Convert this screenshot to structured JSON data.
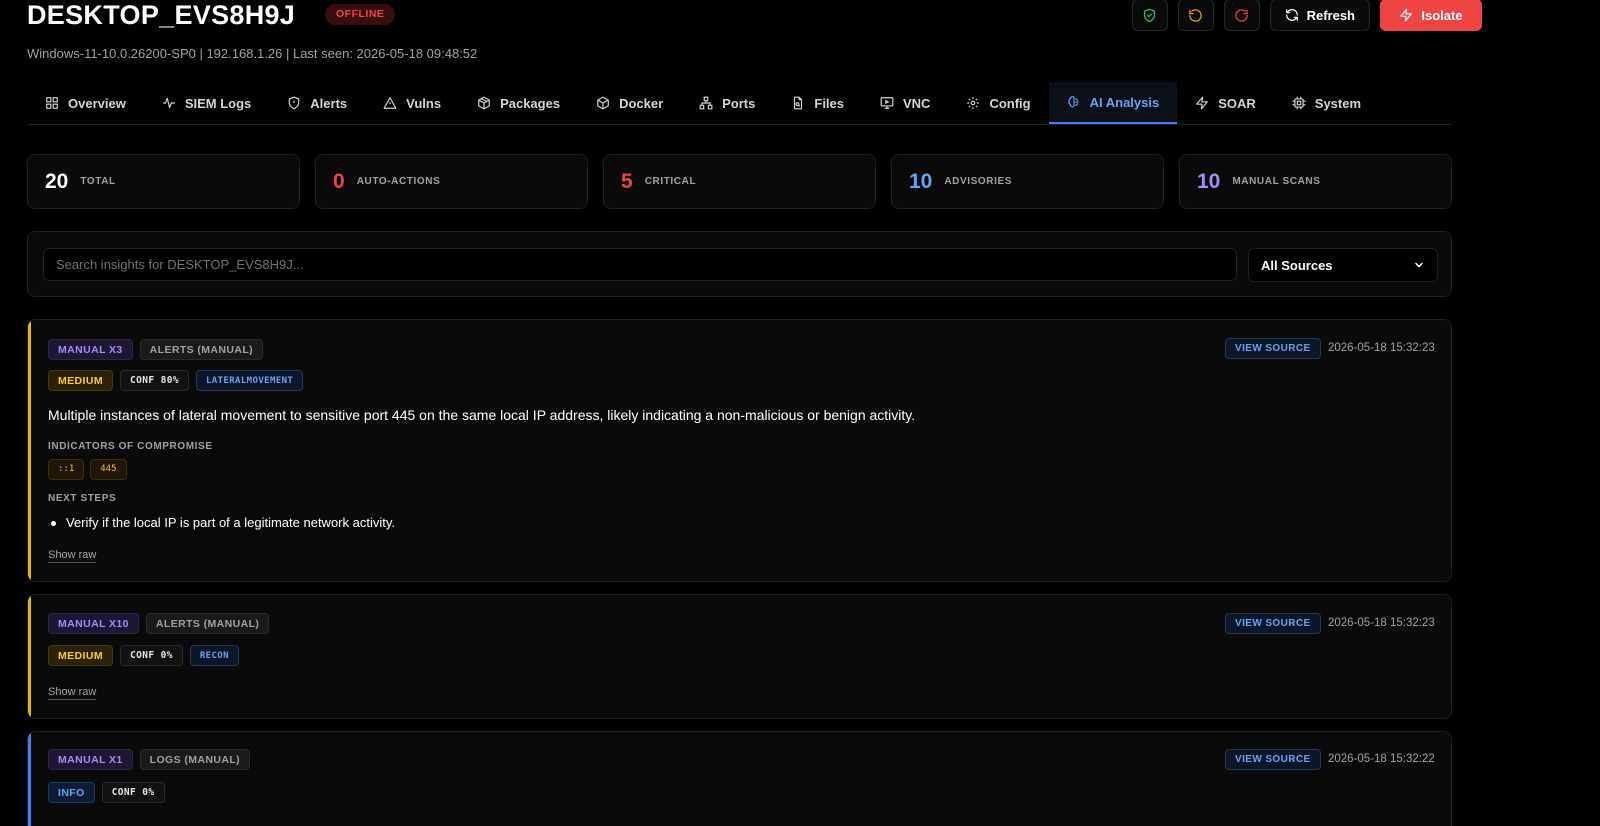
{
  "host": {
    "name": "DESKTOP_EVS8H9J",
    "status": "OFFLINE",
    "subline": "Windows-11-10.0.26200-SP0 | 192.168.1.26 | Last seen: 2026-05-18 09:48:52"
  },
  "actions": {
    "icons": [
      "shield-check-icon",
      "rotate-ccw-icon",
      "restart-icon"
    ],
    "refresh_label": "Refresh",
    "isolate_label": "Isolate"
  },
  "tabs": [
    {
      "label": "Overview",
      "icon": "grid-icon",
      "active": false
    },
    {
      "label": "SIEM Logs",
      "icon": "activity-icon",
      "active": false
    },
    {
      "label": "Alerts",
      "icon": "shield-icon",
      "active": false
    },
    {
      "label": "Vulns",
      "icon": "warning-icon",
      "active": false
    },
    {
      "label": "Packages",
      "icon": "package-icon",
      "active": false
    },
    {
      "label": "Docker",
      "icon": "box-icon",
      "active": false
    },
    {
      "label": "Ports",
      "icon": "network-icon",
      "active": false
    },
    {
      "label": "Files",
      "icon": "file-icon",
      "active": false
    },
    {
      "label": "VNC",
      "icon": "monitor-icon",
      "active": false
    },
    {
      "label": "Config",
      "icon": "gear-icon",
      "active": false
    },
    {
      "label": "AI Analysis",
      "icon": "brain-icon",
      "active": true
    },
    {
      "label": "SOAR",
      "icon": "bolt-icon",
      "active": false
    },
    {
      "label": "System",
      "icon": "cpu-icon",
      "active": false
    }
  ],
  "stats": [
    {
      "value": "20",
      "label": "TOTAL",
      "color": "#ffffff"
    },
    {
      "value": "0",
      "label": "AUTO-ACTIONS",
      "color": "#ef4444"
    },
    {
      "value": "5",
      "label": "CRITICAL",
      "color": "#ef4444"
    },
    {
      "value": "10",
      "label": "ADVISORIES",
      "color": "#60a5fa"
    },
    {
      "value": "10",
      "label": "MANUAL SCANS",
      "color": "#a78bfa"
    }
  ],
  "search": {
    "placeholder": "Search insights for DESKTOP_EVS8H9J...",
    "value": "",
    "source_filter": "All Sources"
  },
  "insights": [
    {
      "run_label": "MANUAL X3",
      "source_label": "ALERTS (MANUAL)",
      "severity": "MEDIUM",
      "confidence": "CONF 80%",
      "tag": "LATERALMOVEMENT",
      "view_source_label": "VIEW SOURCE",
      "timestamp": "2026-05-18 15:32:23",
      "summary": "Multiple instances of lateral movement to sensitive port 445 on the same local IP address, likely indicating a non-malicious or benign activity.",
      "ioc_label": "INDICATORS OF COMPROMISE",
      "iocs": [
        "::1",
        "445"
      ],
      "next_steps_label": "NEXT STEPS",
      "next_steps": [
        "Verify if the local IP is part of a legitimate network activity."
      ],
      "show_raw_label": "Show raw",
      "accent": "#eab308"
    },
    {
      "run_label": "MANUAL X10",
      "source_label": "ALERTS (MANUAL)",
      "severity": "MEDIUM",
      "confidence": "CONF 0%",
      "tag": "RECON",
      "view_source_label": "VIEW SOURCE",
      "timestamp": "2026-05-18 15:32:23",
      "show_raw_label": "Show raw",
      "accent": "#eab308"
    },
    {
      "run_label": "MANUAL X1",
      "source_label": "LOGS (MANUAL)",
      "severity": "INFO",
      "confidence": "CONF 0%",
      "view_source_label": "VIEW SOURCE",
      "timestamp": "2026-05-18 15:32:22",
      "accent": "#3b82f6"
    }
  ]
}
